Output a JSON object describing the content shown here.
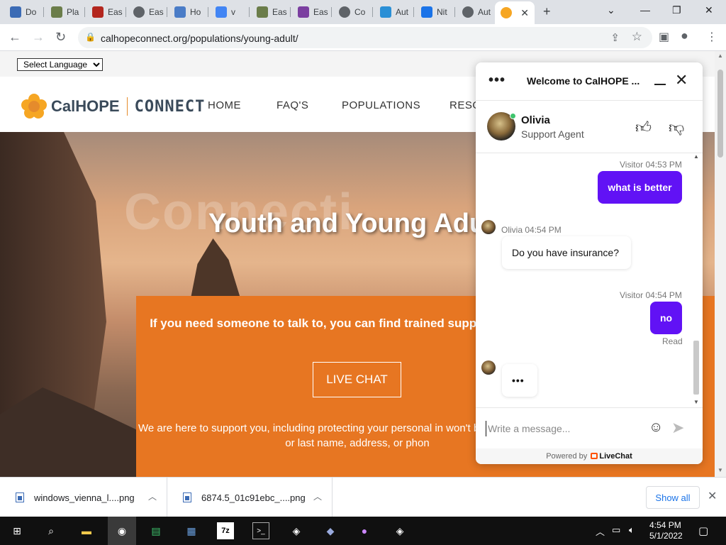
{
  "browser": {
    "tabs": [
      {
        "label": "Do",
        "icon": "tab-favicon",
        "color": "#3b6bb5"
      },
      {
        "label": "Pla",
        "icon": "tab-favicon",
        "color": "#6b7d4a"
      },
      {
        "label": "Eas",
        "icon": "tab-favicon",
        "color": "#b3261e"
      },
      {
        "label": "Eas",
        "icon": "globe-icon",
        "color": "#5f6368"
      },
      {
        "label": "Ho",
        "icon": "tab-favicon",
        "color": "#4a7cc7"
      },
      {
        "label": "v",
        "icon": "google-icon",
        "color": "#4285f4"
      },
      {
        "label": "Eas",
        "icon": "tab-favicon",
        "color": "#6b7d4a"
      },
      {
        "label": "Eas",
        "icon": "tab-favicon",
        "color": "#7b3fa0"
      },
      {
        "label": "Co",
        "icon": "globe-icon",
        "color": "#5f6368"
      },
      {
        "label": "Aut",
        "icon": "tab-favicon",
        "color": "#2a8fd6"
      },
      {
        "label": "Nit",
        "icon": "tab-favicon",
        "color": "#1a73e8"
      },
      {
        "label": "Aut",
        "icon": "globe-icon",
        "color": "#5f6368"
      }
    ],
    "active_tab_icon_color": "#f6a623",
    "url": "calhopeconnect.org/populations/young-adult/"
  },
  "page": {
    "language_select": "Select Language",
    "brand": "CalHOPE",
    "brand_connect": "CONNECT",
    "nav": [
      "HOME",
      "FAQ'S",
      "POPULATIONS",
      "RESO"
    ],
    "hero_bg_word": "Connecti",
    "hero_title": "Youth and Young Adu",
    "cta_text": "If you need someone to talk to, you can find trained supp chat with here:",
    "live_chat_button": "LIVE CHAT",
    "support_text": "We are here to support you, including protecting your personal in won't be a need for your full or last name, address, or phon"
  },
  "chat": {
    "header_title": "Welcome to CalHOPE ...",
    "agent_name": "Olivia",
    "agent_role": "Support Agent",
    "messages": [
      {
        "meta": "Visitor 04:53 PM",
        "text": "what is better"
      },
      {
        "meta": "Olivia 04:54 PM",
        "text": "Do you have insurance?"
      },
      {
        "meta": "Visitor 04:54 PM",
        "text": "no",
        "status": "Read"
      }
    ],
    "typing_indicator": "•••",
    "input_placeholder": "Write a message...",
    "powered_by": "Powered by",
    "powered_brand": "LiveChat",
    "accent_color": "#6112f5"
  },
  "downloads": {
    "items": [
      "windows_vienna_l....png",
      "6874.5_01c91ebc_....png"
    ],
    "show_all": "Show all"
  },
  "taskbar": {
    "time": "4:54 PM",
    "date": "5/1/2022"
  }
}
